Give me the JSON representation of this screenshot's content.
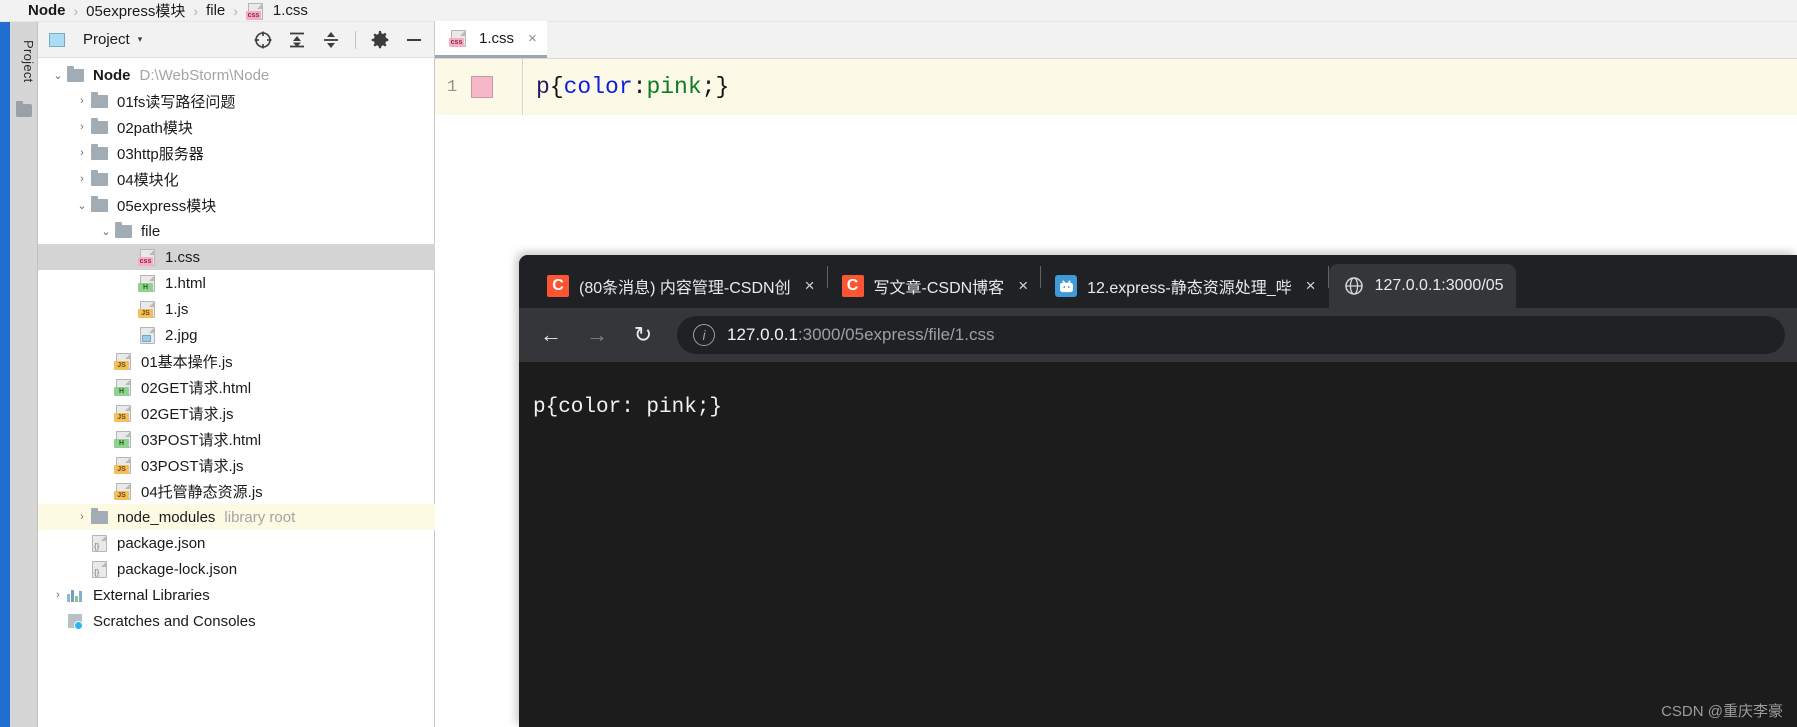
{
  "ide": {
    "breadcrumb": {
      "items": [
        {
          "label": "Node",
          "icon": null,
          "bold": true
        },
        {
          "label": "05express模块",
          "icon": null,
          "bold": false
        },
        {
          "label": "file",
          "icon": null,
          "bold": false
        },
        {
          "label": "1.css",
          "icon": "css-file-icon",
          "bold": false
        }
      ],
      "separator": "›"
    },
    "tool_rail": {
      "label": "Project",
      "icon": "project-folder-icon"
    },
    "panel": {
      "title": "Project",
      "caret": "▾",
      "window_icon": "project-window-icon",
      "buttons": [
        {
          "name": "select-opened-file-button",
          "icon": "crosshair-icon"
        },
        {
          "name": "expand-all-button",
          "icon": "expand-all-icon"
        },
        {
          "name": "collapse-all-button",
          "icon": "collapse-all-icon"
        },
        {
          "name": "settings-button",
          "icon": "gear-icon"
        },
        {
          "name": "hide-button",
          "icon": "minus-icon"
        }
      ]
    },
    "tree": [
      {
        "label": "Node",
        "sub": "D:\\WebStorm\\Node",
        "icon": "folder-icon",
        "twisty": "⌄",
        "indent": 0,
        "bold": true,
        "state": "normal"
      },
      {
        "label": "01fs读写路径问题",
        "sub": "",
        "icon": "folder-icon",
        "twisty": "›",
        "indent": 1,
        "bold": false,
        "state": "normal"
      },
      {
        "label": "02path模块",
        "sub": "",
        "icon": "folder-icon",
        "twisty": "›",
        "indent": 1,
        "bold": false,
        "state": "normal"
      },
      {
        "label": "03http服务器",
        "sub": "",
        "icon": "folder-icon",
        "twisty": "›",
        "indent": 1,
        "bold": false,
        "state": "normal"
      },
      {
        "label": "04模块化",
        "sub": "",
        "icon": "folder-icon",
        "twisty": "›",
        "indent": 1,
        "bold": false,
        "state": "normal"
      },
      {
        "label": "05express模块",
        "sub": "",
        "icon": "folder-icon",
        "twisty": "⌄",
        "indent": 1,
        "bold": false,
        "state": "normal"
      },
      {
        "label": "file",
        "sub": "",
        "icon": "folder-icon",
        "twisty": "⌄",
        "indent": 2,
        "bold": false,
        "state": "normal"
      },
      {
        "label": "1.css",
        "sub": "",
        "icon": "css-file-icon",
        "twisty": "",
        "indent": 3,
        "bold": false,
        "state": "selected"
      },
      {
        "label": "1.html",
        "sub": "",
        "icon": "html-file-icon",
        "twisty": "",
        "indent": 3,
        "bold": false,
        "state": "normal"
      },
      {
        "label": "1.js",
        "sub": "",
        "icon": "js-file-icon",
        "twisty": "",
        "indent": 3,
        "bold": false,
        "state": "normal"
      },
      {
        "label": "2.jpg",
        "sub": "",
        "icon": "image-file-icon",
        "twisty": "",
        "indent": 3,
        "bold": false,
        "state": "normal"
      },
      {
        "label": "01基本操作.js",
        "sub": "",
        "icon": "js-file-icon",
        "twisty": "",
        "indent": 2,
        "bold": false,
        "state": "normal"
      },
      {
        "label": "02GET请求.html",
        "sub": "",
        "icon": "html-file-icon",
        "twisty": "",
        "indent": 2,
        "bold": false,
        "state": "normal"
      },
      {
        "label": "02GET请求.js",
        "sub": "",
        "icon": "js-file-icon",
        "twisty": "",
        "indent": 2,
        "bold": false,
        "state": "normal"
      },
      {
        "label": "03POST请求.html",
        "sub": "",
        "icon": "html-file-icon",
        "twisty": "",
        "indent": 2,
        "bold": false,
        "state": "normal"
      },
      {
        "label": "03POST请求.js",
        "sub": "",
        "icon": "js-file-icon",
        "twisty": "",
        "indent": 2,
        "bold": false,
        "state": "normal"
      },
      {
        "label": "04托管静态资源.js",
        "sub": "",
        "icon": "js-file-icon",
        "twisty": "",
        "indent": 2,
        "bold": false,
        "state": "normal"
      },
      {
        "label": "node_modules",
        "sub": "library root",
        "icon": "folder-icon",
        "twisty": "›",
        "indent": 1,
        "bold": false,
        "state": "highlighted"
      },
      {
        "label": "package.json",
        "sub": "",
        "icon": "json-file-icon",
        "twisty": "",
        "indent": 1,
        "bold": false,
        "state": "normal"
      },
      {
        "label": "package-lock.json",
        "sub": "",
        "icon": "json-file-icon",
        "twisty": "",
        "indent": 1,
        "bold": false,
        "state": "normal"
      },
      {
        "label": "External Libraries",
        "sub": "",
        "icon": "library-icon",
        "twisty": "›",
        "indent": 0,
        "bold": false,
        "state": "normal"
      },
      {
        "label": "Scratches and Consoles",
        "sub": "",
        "icon": "scratches-icon",
        "twisty": "",
        "indent": 0,
        "bold": false,
        "state": "normal"
      }
    ],
    "editor": {
      "tab": {
        "label": "1.css",
        "icon": "css-file-icon",
        "close": "×"
      },
      "gutter": {
        "line_number": "1",
        "color_swatch": "#f6b8c8"
      },
      "code": {
        "selector": "p",
        "brace_open": "{",
        "property": "color",
        "colon": ":",
        "space": " ",
        "value": "pink",
        "semicolon": ";",
        "brace_close": "}"
      }
    }
  },
  "browser": {
    "tabs": [
      {
        "title": "(80条消息) 内容管理-CSDN创",
        "favicon": "csdn-icon",
        "active": false,
        "close": "×"
      },
      {
        "title": "写文章-CSDN博客",
        "favicon": "csdn-icon",
        "active": false,
        "close": "×"
      },
      {
        "title": "12.express-静态资源处理_哔",
        "favicon": "bilibili-icon",
        "active": false,
        "close": "×"
      },
      {
        "title": "127.0.0.1:3000/05",
        "favicon": "globe-icon",
        "active": true,
        "close": ""
      }
    ],
    "toolbar": {
      "back": "←",
      "forward": "→",
      "reload": "↻",
      "info_icon": "site-info-icon",
      "url_host": "127.0.0.1",
      "url_rest": ":3000/05express/file/1.css"
    },
    "page": {
      "text": "p{color: pink;}"
    }
  },
  "watermark": "CSDN @重庆李豪"
}
